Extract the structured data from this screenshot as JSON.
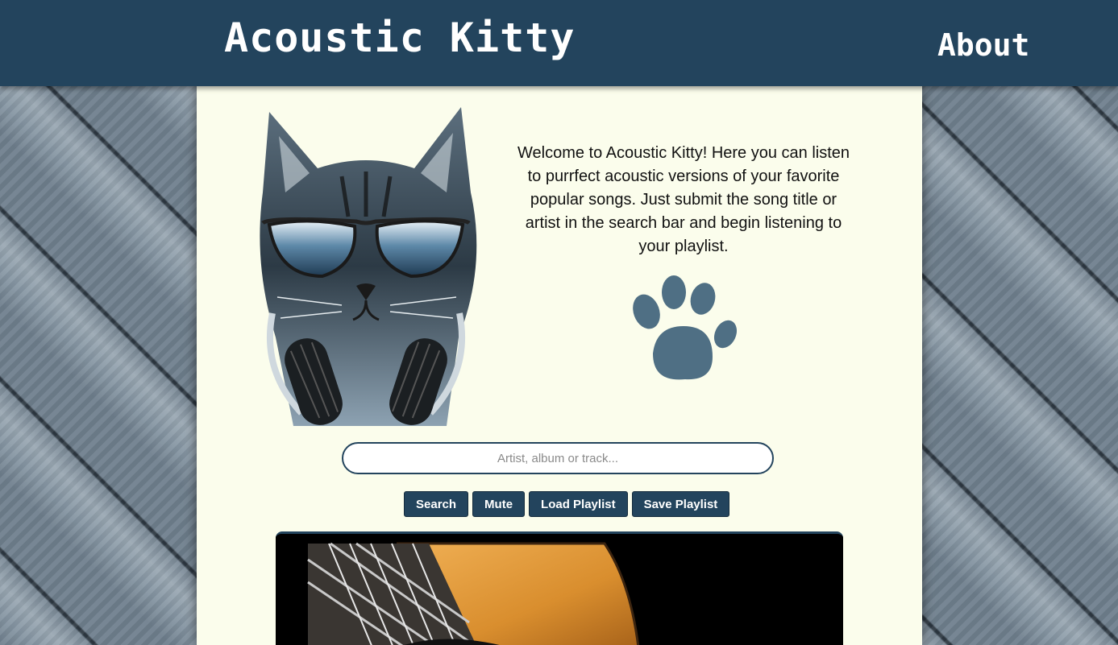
{
  "header": {
    "brand": "Acoustic Kitty",
    "nav_about": "About"
  },
  "intro": {
    "text": "Welcome to Acoustic Kitty! Here you can listen to purrfect acoustic versions of your favorite popular songs. Just submit the song title or artist in the search bar and begin listening to your playlist."
  },
  "search": {
    "placeholder": "Artist, album or track...",
    "value": ""
  },
  "buttons": {
    "search": "Search",
    "mute": "Mute",
    "load_playlist": "Load Playlist",
    "save_playlist": "Save Playlist"
  },
  "icons": {
    "hero": "cat-with-sunglasses-and-headphones-icon",
    "paw": "paw-print-icon",
    "player_art": "acoustic-guitar-image"
  },
  "colors": {
    "header_bg": "#23445d",
    "panel_bg": "#fbfdec",
    "button_bg": "#23445d"
  }
}
